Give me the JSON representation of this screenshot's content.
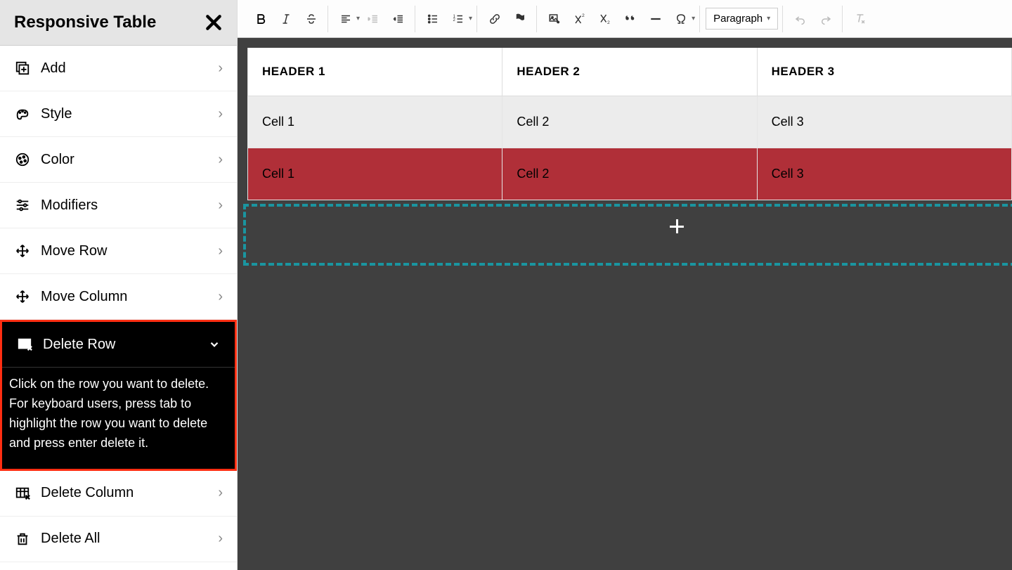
{
  "sidebar": {
    "title": "Responsive Table",
    "items": [
      {
        "label": "Add",
        "icon": "add"
      },
      {
        "label": "Style",
        "icon": "style"
      },
      {
        "label": "Color",
        "icon": "color"
      },
      {
        "label": "Modifiers",
        "icon": "modifiers"
      },
      {
        "label": "Move Row",
        "icon": "move"
      },
      {
        "label": "Move Column",
        "icon": "move"
      },
      {
        "label": "Delete Row",
        "icon": "delete-table",
        "active": true
      },
      {
        "label": "Delete Column",
        "icon": "delete-table"
      },
      {
        "label": "Delete All",
        "icon": "trash"
      }
    ],
    "help_text": "Click on the row you want to delete. For keyboard users, press tab to highlight the row you want to delete and press enter delete it."
  },
  "toolbar": {
    "paragraph_label": "Paragraph"
  },
  "table_data": {
    "headers": [
      "HEADER 1",
      "HEADER 2",
      "HEADER 3"
    ],
    "rows": [
      {
        "cells": [
          "Cell 1",
          "Cell 2",
          "Cell 3"
        ],
        "style": "gray"
      },
      {
        "cells": [
          "Cell 1",
          "Cell 2",
          "Cell 3"
        ],
        "style": "selected"
      }
    ]
  }
}
